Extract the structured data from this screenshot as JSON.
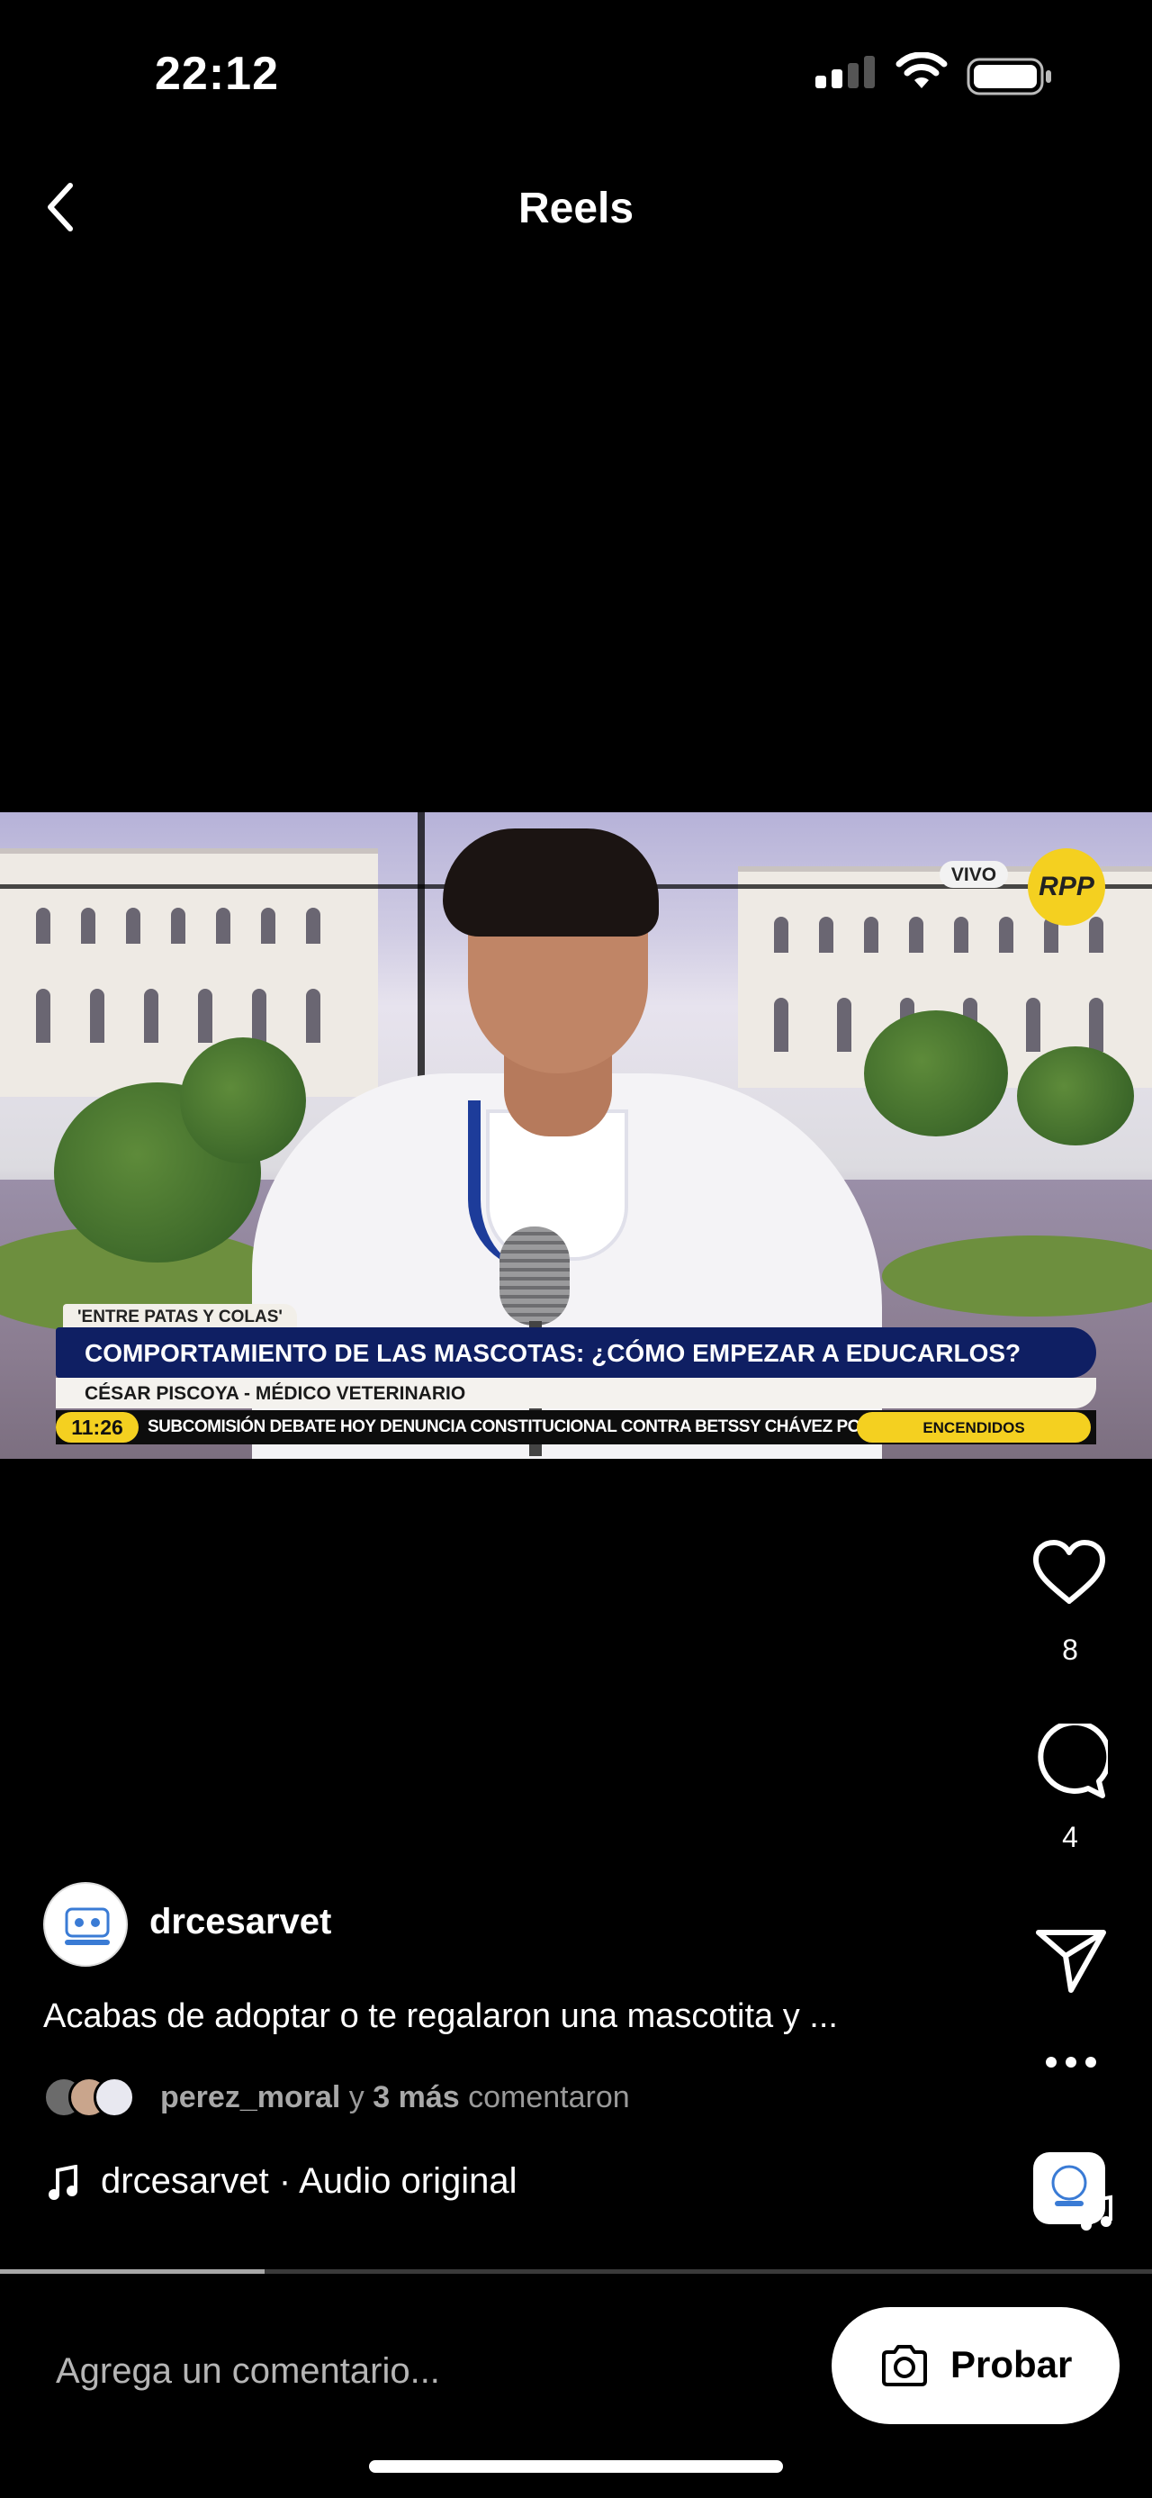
{
  "status_bar": {
    "time": "22:12"
  },
  "nav": {
    "title": "Reels"
  },
  "video": {
    "segment_tag": "'ENTRE PATAS Y COLAS'",
    "headline": "COMPORTAMIENTO DE LAS MASCOTAS: ¿CÓMO EMPEZAR A EDUCARLOS?",
    "subline": "CÉSAR PISCOYA - MÉDICO VETERINARIO",
    "ticker_time": "11:26",
    "ticker_text": "SUBCOMISIÓN DEBATE HOY DENUNCIA CONSTITUCIONAL CONTRA BETSSY CHÁVEZ POR GOLPE DE ESTADO",
    "ticker_brand": "ENCENDIDOS",
    "live_badge": "VIVO",
    "channel_logo": "RPP"
  },
  "actions": {
    "like_count": "8",
    "comment_count": "4"
  },
  "post": {
    "username": "drcesarvet",
    "caption": "Acabas de adoptar o te regalaron una mascotita y ...",
    "commenter": "perez_moral",
    "comment_joiner": " y ",
    "others": "3 más",
    "comment_suffix": " comentaron",
    "audio": "drcesarvet · Audio original"
  },
  "progress": {
    "fraction": 0.23
  },
  "comment_bar": {
    "placeholder": "Agrega un comentario...",
    "try_label": "Probar"
  },
  "icons": [
    "back-chevron-icon",
    "signal-icon",
    "wifi-icon",
    "battery-icon",
    "heart-icon",
    "comment-bubble-icon",
    "share-send-icon",
    "more-icon",
    "music-note-icon",
    "camera-icon"
  ],
  "colors": {
    "background": "#000000",
    "headline_bar": "#0f1f63",
    "accent_yellow": "#f4d020"
  }
}
